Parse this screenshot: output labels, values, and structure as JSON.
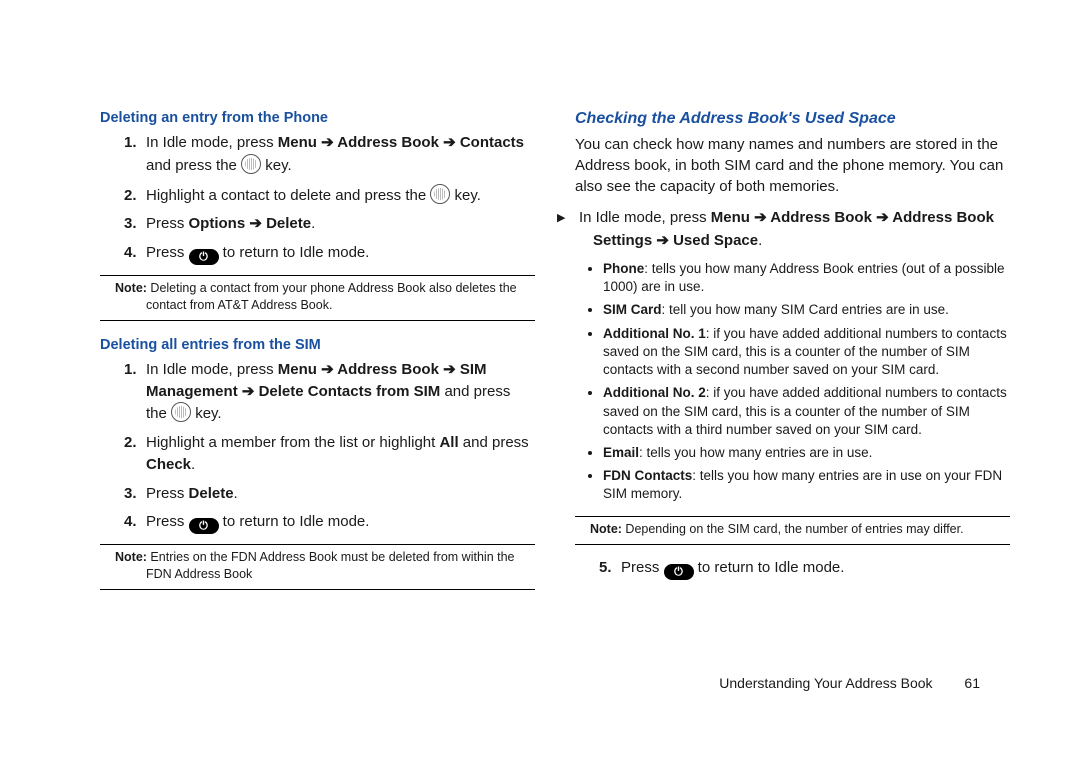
{
  "left": {
    "sec1": {
      "heading": "Deleting an entry from the Phone",
      "step1_a": "In Idle mode, press ",
      "step1_b": "Menu ➔ Address Book ➔ Contacts",
      "step1_c": " and press the ",
      "step1_d": " key.",
      "step2_a": "Highlight a contact to delete and press the ",
      "step2_b": " key.",
      "step3_a": "Press ",
      "step3_b": "Options ➔ Delete",
      "step3_c": ".",
      "step4_a": "Press ",
      "step4_b": " to return to Idle mode.",
      "note_label": "Note:",
      "note_text": " Deleting a contact from your phone Address Book also deletes the contact from AT&T Address Book."
    },
    "sec2": {
      "heading": "Deleting all entries from the SIM",
      "step1_a": "In Idle mode, press ",
      "step1_b": "Menu ➔ Address Book ➔ SIM Management ➔ Delete Contacts from SIM",
      "step1_c": " and press the ",
      "step1_d": " key.",
      "step2_a": "Highlight a member from the list or highlight ",
      "step2_aa": "All",
      "step2_b": " and press ",
      "step2_c": "Check",
      "step2_d": ".",
      "step3_a": "Press ",
      "step3_b": "Delete",
      "step3_c": ".",
      "step4_a": "Press ",
      "step4_b": " to return to Idle mode.",
      "note_label": "Note:",
      "note_text": " Entries on the FDN Address Book must be deleted from within the FDN Address Book"
    }
  },
  "right": {
    "heading": "Checking the Address Book's Used Space",
    "intro": "You can check how many names and numbers are stored in the Address book, in both SIM card and the phone memory. You can also see the capacity of both memories.",
    "seq_a": "In Idle mode, press ",
    "seq_b": "Menu ➔ Address Book ➔ Address Book Settings ➔ Used Space",
    "seq_c": ".",
    "bullets": [
      {
        "b": "Phone",
        "t": ": tells you how many Address Book entries (out of a possible 1000) are in use."
      },
      {
        "b": "SIM Card",
        "t": ": tell you how many SIM Card entries are in use."
      },
      {
        "b": "Additional No. 1",
        "t": ": if you have added additional numbers to contacts saved on the SIM card, this is a counter of the number of SIM contacts with a second number saved on your SIM card."
      },
      {
        "b": "Additional No. 2",
        "t": ": if you have added additional numbers to contacts saved on the SIM card, this is a counter of the number of SIM contacts with a third number saved on your SIM card."
      },
      {
        "b": "Email",
        "t": ": tells you how many entries are in use."
      },
      {
        "b": "FDN Contacts",
        "t": ": tells you how many entries are in use on your FDN SIM memory."
      }
    ],
    "note_label": "Note:",
    "note_text": " Depending on the SIM card, the number of entries may differ.",
    "step5_a": "Press ",
    "step5_b": " to return to Idle mode."
  },
  "footer": {
    "chapter": "Understanding Your Address Book",
    "page": "61"
  },
  "icons": {
    "end_glyph": "⏻"
  }
}
